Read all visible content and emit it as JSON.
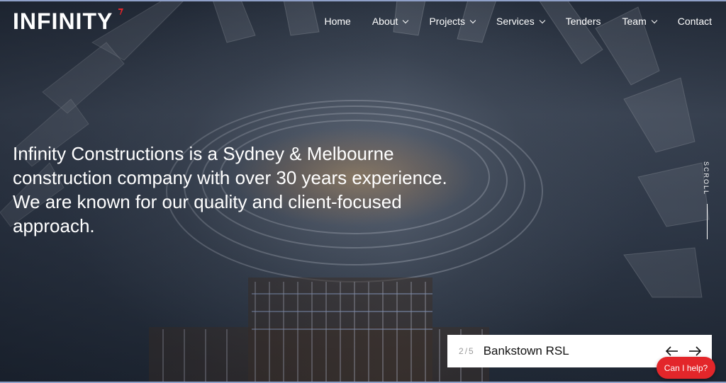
{
  "brand": {
    "name": "INFINITY",
    "accent_color": "#e3262a"
  },
  "nav": {
    "items": [
      {
        "label": "Home",
        "has_dropdown": false
      },
      {
        "label": "About",
        "has_dropdown": true
      },
      {
        "label": "Projects",
        "has_dropdown": true
      },
      {
        "label": "Services",
        "has_dropdown": true
      },
      {
        "label": "Tenders",
        "has_dropdown": false
      },
      {
        "label": "Team",
        "has_dropdown": true
      },
      {
        "label": "Contact",
        "has_dropdown": false
      }
    ]
  },
  "hero": {
    "headline": "Infinity Constructions is a Sydney & Melbourne construction company with over 30 years experience. We are known for our quality and client-focused approach.",
    "scroll_label": "SCROLL"
  },
  "slider": {
    "current": "2",
    "separator": "/",
    "total": "5",
    "title": "Bankstown RSL",
    "prev_icon": "arrow-left-icon",
    "next_icon": "arrow-right-icon"
  },
  "help": {
    "label": "Can I help?"
  }
}
